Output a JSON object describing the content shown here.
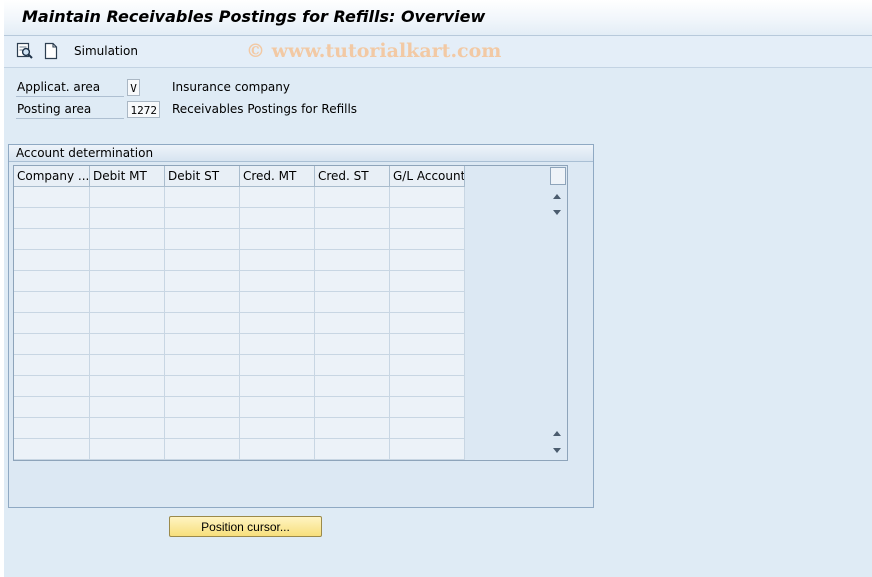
{
  "window": {
    "title": "Maintain Receivables Postings for Refills: Overview"
  },
  "toolbar": {
    "icons": [
      "find-icon",
      "new-document-icon"
    ],
    "simulation_label": "Simulation"
  },
  "watermark": "© www.tutorialkart.com",
  "header_fields": [
    {
      "label": "Applicat. area",
      "value": "V",
      "description": "Insurance company"
    },
    {
      "label": "Posting area",
      "value": "1272",
      "description": "Receivables Postings for Refills"
    }
  ],
  "group": {
    "title": "Account determination"
  },
  "table": {
    "columns": [
      "Company ...",
      "Debit MT",
      "Debit ST",
      "Cred. MT",
      "Cred. ST",
      "G/L Account"
    ],
    "row_count": 13
  },
  "buttons": {
    "position_cursor": "Position cursor..."
  },
  "colors": {
    "screen_background": "#dfebf5",
    "button_yellow": "#f7df7c",
    "watermark": "#f2c9a4"
  }
}
